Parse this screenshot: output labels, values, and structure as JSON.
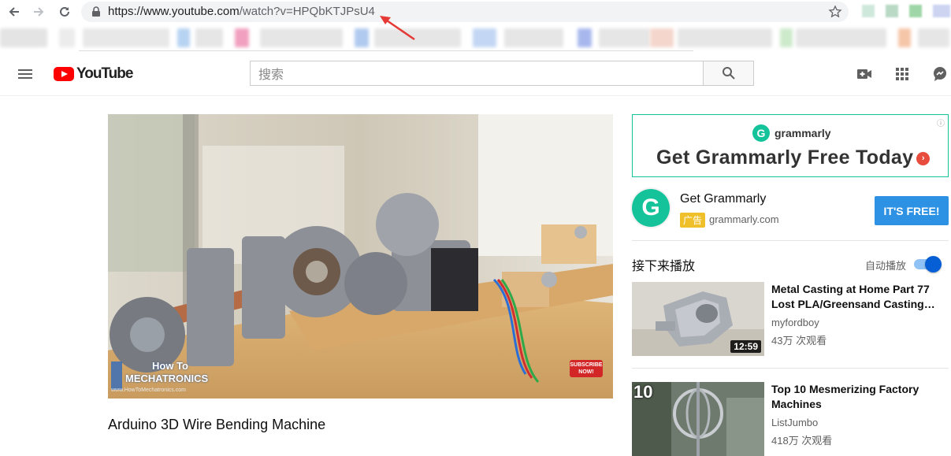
{
  "browser": {
    "url_host": "https://www.youtube.com",
    "url_path": "/watch?v=HPQbKTJPsU4"
  },
  "header": {
    "logo_text": "YouTube",
    "search_placeholder": "搜索"
  },
  "video": {
    "title": "Arduino 3D Wire Bending Machine",
    "watermark_top": "How To",
    "watermark_bottom": "MECHATRONICS",
    "watermark_url": "www.HowToMechatronics.com",
    "subscribe_badge": "SUBSCRIBE NOW!"
  },
  "ad": {
    "brand": "grammarly",
    "headline": "Get Grammarly Free Today",
    "info_icon": "i",
    "promo_name": "Get Grammarly",
    "promo_badge": "广告",
    "promo_domain": "grammarly.com",
    "cta": "IT'S FREE!"
  },
  "up_next": {
    "label": "接下来播放",
    "autoplay_label": "自动播放",
    "autoplay_on": true
  },
  "recommendations": [
    {
      "title": "Metal Casting at Home Part 77 Lost PLA/Greensand Casting…",
      "channel": "myfordboy",
      "views": "43万 次观看",
      "duration": "12:59"
    },
    {
      "title": "Top 10 Mesmerizing Factory Machines",
      "channel": "ListJumbo",
      "views": "418万 次观看",
      "thumb_badge": "10"
    }
  ],
  "colors": {
    "youtube_red": "#ff0000",
    "grammarly_green": "#15c39a",
    "cta_blue": "#2d91e4",
    "toggle_blue": "#065fd4",
    "annotation_arrow": "#e53935"
  }
}
